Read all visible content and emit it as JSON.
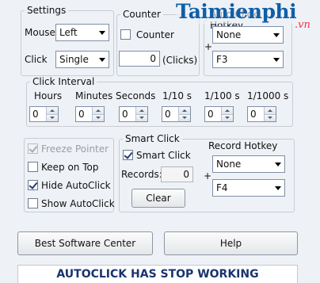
{
  "settings": {
    "legend": "Settings",
    "mouse_label": "Mouse",
    "mouse_value": "Left",
    "click_label": "Click",
    "click_value": "Single"
  },
  "counter": {
    "legend": "Counter",
    "checkbox_label": "Counter",
    "checked": false,
    "value": "0",
    "unit": "(Clicks)"
  },
  "autoclick_hotkey": {
    "legend": "Auto Click Hotkey",
    "modifier_value": "None",
    "plus": "+",
    "key_value": "F3"
  },
  "click_interval": {
    "legend": "Click Interval",
    "fields": [
      {
        "label": "Hours",
        "value": "0"
      },
      {
        "label": "Minutes",
        "value": "0"
      },
      {
        "label": "Seconds",
        "value": "0"
      },
      {
        "label": "1/10 s",
        "value": "0"
      },
      {
        "label": "1/100 s",
        "value": "0"
      },
      {
        "label": "1/1000 s",
        "value": "0"
      }
    ]
  },
  "options": {
    "freeze_pointer": {
      "label": "Freeze Pointer",
      "checked": true,
      "enabled": false
    },
    "keep_on_top": {
      "label": "Keep on Top",
      "checked": false
    },
    "hide_autoclick": {
      "label": "Hide AutoClick",
      "checked": true
    },
    "show_autoclick": {
      "label": "Show AutoClick",
      "checked": false
    }
  },
  "smart_click": {
    "legend": "Smart Click",
    "checkbox_label": "Smart Click",
    "checked": true,
    "records_label": "Records:",
    "records_value": "0",
    "clear_label": "Clear"
  },
  "record_hotkey": {
    "label": "Record Hotkey",
    "modifier_value": "None",
    "plus": "+",
    "key_value": "F4"
  },
  "buttons": {
    "best_software": "Best Software Center",
    "help": "Help"
  },
  "status_banner": "AUTOCLICK HAS STOP WORKING",
  "watermark": {
    "text": "Taimienphi",
    "suffix": ".vn"
  },
  "colors": {
    "accent_text": "#1a3470",
    "logo_blue": "#0f5fa8",
    "background": "#eef1f6"
  }
}
